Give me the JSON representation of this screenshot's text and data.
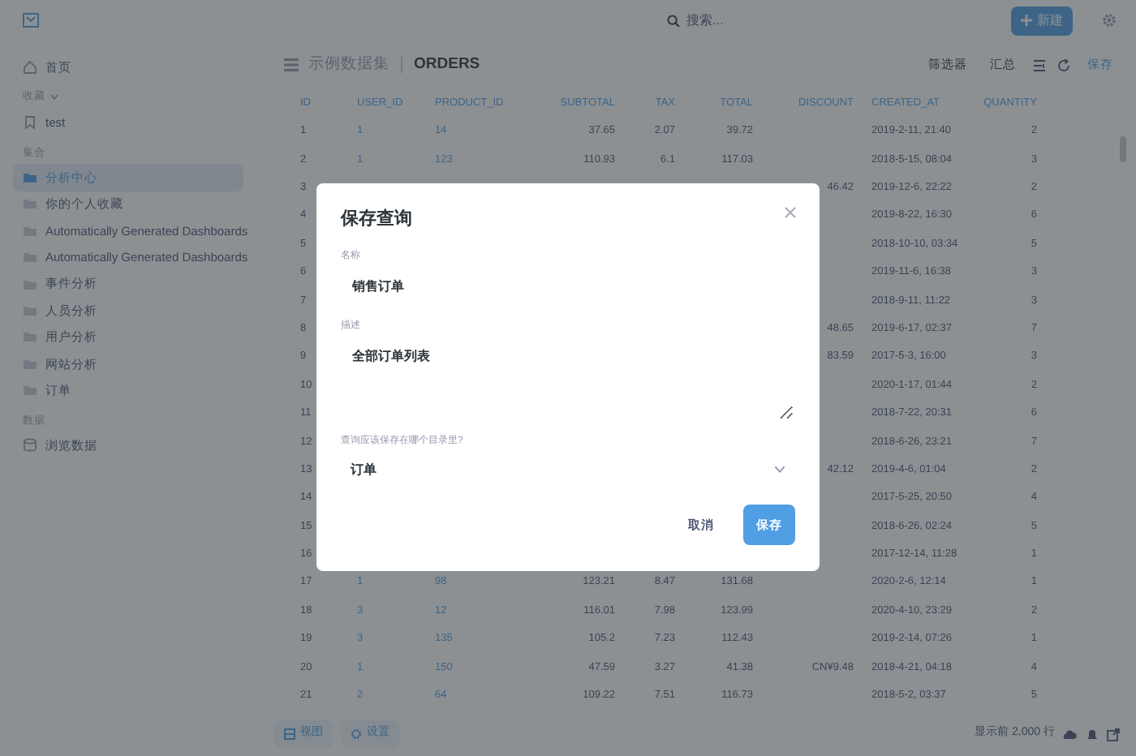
{
  "top_bar": {
    "search": {
      "placeholder": "搜索..."
    },
    "new_button": "新建"
  },
  "sidebar": {
    "sections": [
      {
        "kind": "home",
        "items": [
          {
            "label": "首页",
            "selected": false
          }
        ]
      },
      {
        "kind": "bookmarks",
        "heading": "收藏",
        "items": [
          {
            "label": "test",
            "selected": false
          }
        ]
      },
      {
        "kind": "collections",
        "heading": "集合",
        "items": [
          {
            "label": "分析中心",
            "selected": true
          },
          {
            "label": "你的个人收藏",
            "selected": false
          },
          {
            "label": "Automatically Generated Dashboards",
            "selected": false
          },
          {
            "label": "Automatically Generated Dashboards",
            "selected": false
          },
          {
            "label": "事件分析",
            "selected": false
          },
          {
            "label": "人员分析",
            "selected": false
          },
          {
            "label": "用户分析",
            "selected": false
          },
          {
            "label": "网站分析",
            "selected": false
          },
          {
            "label": "订单",
            "selected": false
          }
        ]
      },
      {
        "kind": "data",
        "heading": "数据",
        "items": [
          {
            "label": "浏览数据",
            "selected": false
          }
        ]
      }
    ]
  },
  "header": {
    "breadcrumb": [
      "示例数据集",
      "ORDERS"
    ],
    "actions": [
      "筛选器",
      "汇总"
    ],
    "save": "保存"
  },
  "table": {
    "columns": [
      {
        "label": "ID",
        "kind": "id"
      },
      {
        "label": "USER_ID",
        "kind": "fk"
      },
      {
        "label": "PRODUCT_ID",
        "kind": "fk"
      },
      {
        "label": "SUBTOTAL",
        "kind": "number"
      },
      {
        "label": "TAX",
        "kind": "number"
      },
      {
        "label": "TOTAL",
        "kind": "number"
      },
      {
        "label": "DISCOUNT",
        "kind": "number"
      },
      {
        "label": "CREATED_AT",
        "kind": "date"
      },
      {
        "label": "QUANTITY",
        "kind": "number"
      }
    ],
    "rows": [
      {
        "id": "1",
        "user_id": "1",
        "product_id": "14",
        "subtotal": "37.65",
        "tax": "2.07",
        "total": "39.72",
        "created_at": "2019-2-11, 21:40",
        "quantity": "2"
      },
      {
        "id": "2",
        "user_id": "1",
        "product_id": "123",
        "subtotal": "110.93",
        "tax": "6.1",
        "total": "117.03",
        "created_at": "2018-5-15, 08:04",
        "quantity": "3"
      },
      {
        "id": "3",
        "discount": "46.42",
        "created_at": "2019-12-6, 22:22",
        "quantity": "2"
      },
      {
        "id": "4",
        "created_at": "2019-8-22, 16:30",
        "quantity": "6"
      },
      {
        "id": "5",
        "created_at": "2018-10-10, 03:34",
        "quantity": "5"
      },
      {
        "id": "6",
        "created_at": "2019-11-6, 16:38",
        "quantity": "3"
      },
      {
        "id": "7",
        "created_at": "2018-9-11, 11:22",
        "quantity": "3"
      },
      {
        "id": "8",
        "discount": "48.65",
        "created_at": "2019-6-17, 02:37",
        "quantity": "7"
      },
      {
        "id": "9",
        "discount": "83.59",
        "created_at": "2017-5-3, 16:00",
        "quantity": "3"
      },
      {
        "id": "10",
        "created_at": "2020-1-17, 01:44",
        "quantity": "2"
      },
      {
        "id": "11",
        "created_at": "2018-7-22, 20:31",
        "quantity": "6"
      },
      {
        "id": "12",
        "created_at": "2018-6-26, 23:21",
        "quantity": "7"
      },
      {
        "id": "13",
        "discount": "42.12",
        "created_at": "2019-4-6, 01:04",
        "quantity": "2"
      },
      {
        "id": "14",
        "created_at": "2017-5-25, 20:50",
        "quantity": "4"
      },
      {
        "id": "15",
        "created_at": "2018-6-26, 02:24",
        "quantity": "5"
      },
      {
        "id": "16",
        "created_at": "2017-12-14, 11:28",
        "quantity": "1"
      },
      {
        "id": "17",
        "user_id": "1",
        "product_id": "98",
        "subtotal": "123.21",
        "tax": "8.47",
        "total": "131.68",
        "created_at": "2020-2-6, 12:14",
        "quantity": "1"
      },
      {
        "id": "18",
        "user_id": "3",
        "product_id": "12",
        "subtotal": "116.01",
        "tax": "7.98",
        "total": "123.99",
        "created_at": "2020-4-10, 23:29",
        "quantity": "2"
      },
      {
        "id": "19",
        "user_id": "3",
        "product_id": "135",
        "subtotal": "105.2",
        "tax": "7.23",
        "total": "112.43",
        "created_at": "2019-2-14, 07:26",
        "quantity": "1"
      },
      {
        "id": "20",
        "user_id": "1",
        "product_id": "150",
        "subtotal": "47.59",
        "tax": "3.27",
        "total": "41.38",
        "discount": "CN¥9.48",
        "created_at": "2018-4-21, 04:18",
        "quantity": "4"
      },
      {
        "id": "21",
        "user_id": "2",
        "product_id": "64",
        "subtotal": "109.22",
        "tax": "7.51",
        "total": "116.73",
        "created_at": "2018-5-2, 03:37",
        "quantity": "5"
      }
    ]
  },
  "footer": {
    "buttons": [
      "视图",
      "设置"
    ],
    "row_count": "显示前 2,000 行"
  },
  "dialog": {
    "title": "保存查询",
    "fields": [
      {
        "kind": "input",
        "label": "名称",
        "value": "销售订单"
      },
      {
        "kind": "textarea",
        "label": "描述",
        "value": "全部订单列表"
      },
      {
        "kind": "select",
        "label": "查询应该保存在哪个目录里?",
        "value": "订单"
      }
    ],
    "cancel": "取消",
    "save": "保存"
  }
}
